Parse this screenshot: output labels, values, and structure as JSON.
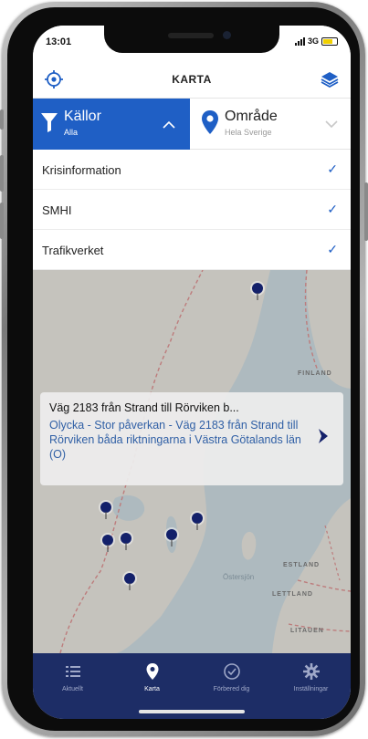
{
  "status_bar": {
    "time": "13:01",
    "network": "3G"
  },
  "navbar": {
    "title": "KARTA",
    "left_icon": "locate-icon",
    "right_icon": "layers-icon"
  },
  "filters": {
    "sources": {
      "title": "Källor",
      "subtitle": "Alla",
      "icon": "filter-icon",
      "chevron": "chevron-up-icon"
    },
    "area": {
      "title": "Område",
      "subtitle": "Hela Sverige",
      "icon": "location-pin-icon",
      "chevron": "chevron-down-icon"
    }
  },
  "source_list": [
    {
      "label": "Krisinformation",
      "checked": true
    },
    {
      "label": "SMHI",
      "checked": true
    },
    {
      "label": "Trafikverket",
      "checked": true
    }
  ],
  "map": {
    "labels": [
      "FINLAND",
      "ESTLAND",
      "LETTLAND",
      "LITAUEN",
      "Östersjön"
    ],
    "marker_count": 7
  },
  "info_card": {
    "title": "Väg 2183 från Strand till Rörviken b...",
    "description": "Olycka - Stor påverkan - Väg 2183 från Strand till Rörviken båda riktningarna i Västra Götalands län (O)"
  },
  "tabbar": {
    "items": [
      {
        "label": "Aktuellt",
        "icon": "list-icon",
        "active": false
      },
      {
        "label": "Karta",
        "icon": "map-pin-icon",
        "active": true
      },
      {
        "label": "Förbered dig",
        "icon": "checkmark-circle-icon",
        "active": false
      },
      {
        "label": "Inställningar",
        "icon": "gear-icon",
        "active": false
      }
    ]
  },
  "colors": {
    "accent": "#1f5fc5",
    "tabbar": "#1d2d66",
    "marker": "#13206a",
    "link_text": "#2f5fa5"
  }
}
